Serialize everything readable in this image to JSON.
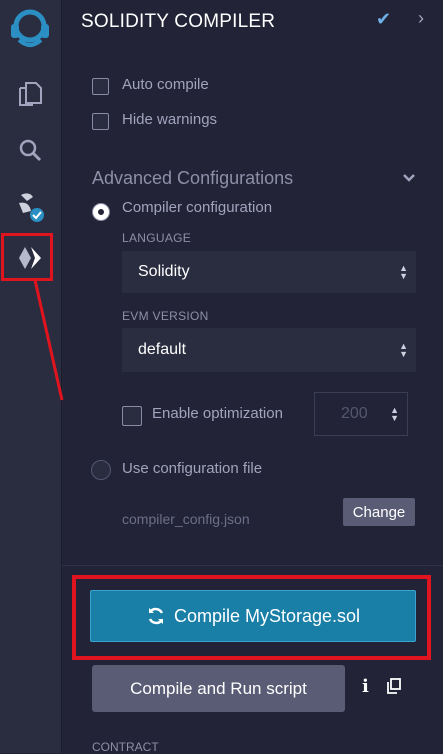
{
  "colors": {
    "accent": "#1a7fa7",
    "highlight": "#e0141e",
    "panel_bg": "#222336",
    "iconbar_bg": "#2a2c3f"
  },
  "iconbar": {
    "items": [
      {
        "name": "remix-logo-icon"
      },
      {
        "name": "file-explorer-icon"
      },
      {
        "name": "search-icon"
      },
      {
        "name": "plugin-manager-icon"
      },
      {
        "name": "solidity-compiler-icon",
        "active": true
      }
    ]
  },
  "header": {
    "title": "SOLIDITY COMPILER",
    "check_glyph": "✔",
    "chevron_glyph": "›"
  },
  "options": {
    "auto_compile": {
      "label": "Auto compile",
      "checked": false
    },
    "hide_warnings": {
      "label": "Hide warnings",
      "checked": false
    }
  },
  "advanced": {
    "title": "Advanced Configurations",
    "compiler_configuration": {
      "label": "Compiler configuration",
      "selected": true
    },
    "language": {
      "label": "LANGUAGE",
      "value": "Solidity"
    },
    "evm_version": {
      "label": "EVM VERSION",
      "value": "default"
    },
    "optimization": {
      "label": "Enable optimization",
      "checked": false,
      "runs": "200"
    },
    "use_config_file": {
      "label": "Use configuration file",
      "selected": false
    },
    "config_file_name": "compiler_config.json",
    "change_label": "Change"
  },
  "actions": {
    "compile_label": "Compile MyStorage.sol",
    "compile_run_label": "Compile and Run script",
    "info_glyph": "i"
  },
  "contract_label": "CONTRACT"
}
